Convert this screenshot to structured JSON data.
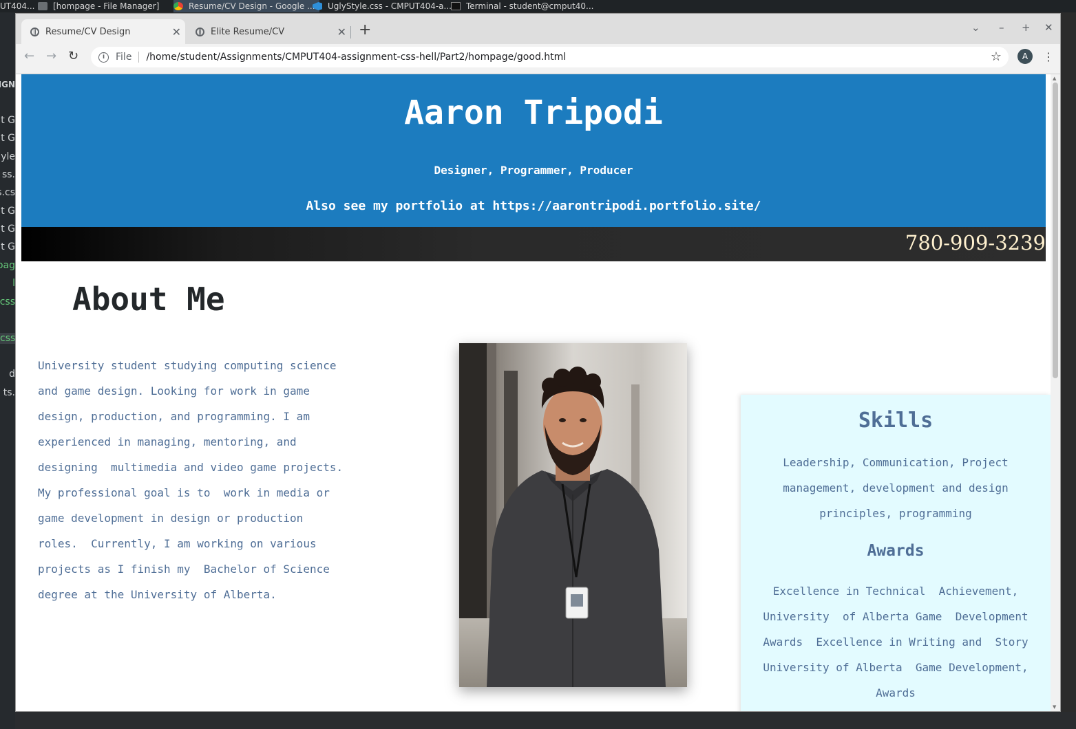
{
  "taskbar": {
    "items": [
      {
        "label": "UT404..."
      },
      {
        "label": "[hompage - File Manager]"
      },
      {
        "label": "Resume/CV Design - Google ..."
      },
      {
        "label": "UglyStyle.css - CMPUT404-a..."
      },
      {
        "label": "Terminal - student@cmput40..."
      }
    ]
  },
  "editor_strip": {
    "lines": [
      "IGN",
      "t G",
      "t G",
      "yle",
      "ss.",
      "s.cs",
      "t G",
      "t G",
      "t G",
      "pag",
      "l",
      ".css",
      "css",
      "d",
      "ts."
    ]
  },
  "browser": {
    "tabs": [
      {
        "label": "Resume/CV Design",
        "active": true
      },
      {
        "label": "Elite Resume/CV",
        "active": false
      }
    ],
    "address": {
      "scheme_label": "File",
      "url": "/home/student/Assignments/CMPUT404-assignment-css-hell/Part2/hompage/good.html"
    },
    "profile_initial": "A"
  },
  "page": {
    "header": {
      "name": "Aaron Tripodi",
      "tagline": "Designer, Programmer, Producer",
      "portfolio": "Also see my portfolio at https://aarontripodi.portfolio.site/",
      "background_color": "#1c7cbf"
    },
    "phone": "780-909-3239",
    "about": {
      "title": "About Me",
      "lines": [
        "University student studying computing science",
        "and game design. Looking for work in game",
        "design, production, and programming. I am",
        "experienced in managing, mentoring, and",
        "designing  multimedia and video game projects.",
        "My professional goal is to  work in media or",
        "game development in design or production",
        "roles.  Currently, I am working on various",
        "projects as I finish my  Bachelor of Science",
        "degree at the University of Alberta."
      ]
    },
    "skills": {
      "title": "Skills",
      "lines": [
        "Leadership, Communication, Project",
        "management, development and design",
        "principles, programming"
      ]
    },
    "awards": {
      "title": "Awards",
      "lines": [
        "Excellence in Technical  Achievement,",
        "University  of Alberta Game  Development",
        "Awards  Excellence in Writing and  Story",
        "University of Alberta  Game Development,",
        "Awards"
      ]
    },
    "colors": {
      "body_text": "#4f6e96",
      "panel_background": "#e3fbff",
      "phone_text": "#fff1cf"
    }
  }
}
